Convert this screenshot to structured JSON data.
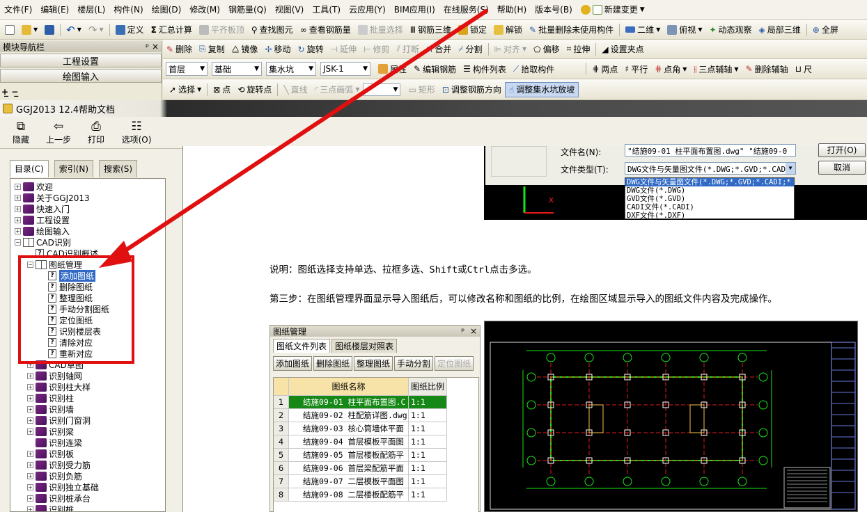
{
  "menubar": {
    "items": [
      "文件(F)",
      "编辑(E)",
      "楼层(L)",
      "构件(N)",
      "绘图(D)",
      "修改(M)",
      "钢筋量(Q)",
      "视图(V)",
      "工具(T)",
      "云应用(Y)",
      "BIM应用(I)",
      "在线服务(S)",
      "帮助(H)",
      "版本号(B)"
    ],
    "new_change": "新建变更"
  },
  "toolbar1": {
    "define": "定义",
    "summary": "汇总计算",
    "flat_slab": "平齐板顶",
    "find_element": "查找图元",
    "view_rebar": "查看钢筋量",
    "batch_select": "批量选择",
    "rebar_3d": "钢筋三维",
    "lock": "锁定",
    "unlock": "解锁",
    "batch_delete": "批量删除未使用构件",
    "view_2d": "二维",
    "view_top": "俯视",
    "dynamic_view": "动态观察",
    "local_3d": "局部三维",
    "full_screen": "全屏"
  },
  "toolbar2": {
    "delete": "删除",
    "copy": "复制",
    "mirror": "镜像",
    "move": "移动",
    "rotate": "旋转",
    "extend": "延伸",
    "trim": "修剪",
    "break": "打断",
    "merge": "合并",
    "split": "分割",
    "align": "对齐",
    "offset": "偏移",
    "stretch": "拉伸",
    "set_grip": "设置夹点"
  },
  "toolbar3": {
    "floor": "首层",
    "category": "基础",
    "element_type": "集水坑",
    "element": "JSK-1",
    "property": "属性",
    "edit_rebar": "编辑钢筋",
    "element_list": "构件列表",
    "pick_element": "拾取构件",
    "two_points": "两点",
    "parallel": "平行",
    "point_angle": "点角",
    "three_point_aux": "三点辅轴",
    "delete_aux": "删除辅轴",
    "dimension": "尺"
  },
  "toolbar4": {
    "select": "选择",
    "point": "点",
    "rotate_point": "旋转点",
    "line": "直线",
    "three_point_arc": "三点画弧",
    "rect": "矩形",
    "adjust_rebar_dir": "调整钢筋方向",
    "adjust_pit_slope": "调整集水坑放坡"
  },
  "left_nav": {
    "title": "模块导航栏",
    "project_settings": "工程设置",
    "drawing_input": "绘图输入",
    "pin": "ᵖ",
    "close": "×"
  },
  "help": {
    "title": "GGJ2013 12.4帮助文档",
    "toolbar": {
      "hide": "隐藏",
      "back": "上一步",
      "print": "打印",
      "options": "选项(O)"
    },
    "tabs": {
      "contents": "目录(C)",
      "index": "索引(N)",
      "search": "搜索(S)"
    },
    "tree": [
      {
        "label": "欢迎",
        "exp": "+",
        "icon": "book"
      },
      {
        "label": "关于GGJ2013",
        "exp": "+",
        "icon": "book"
      },
      {
        "label": "快速入门",
        "exp": "+",
        "icon": "book"
      },
      {
        "label": "工程设置",
        "exp": "+",
        "icon": "book"
      },
      {
        "label": "绘图输入",
        "exp": "+",
        "icon": "book"
      },
      {
        "label": "CAD识别",
        "exp": "−",
        "icon": "obook"
      },
      {
        "label": "CAD识别概述",
        "exp": "",
        "icon": "q",
        "indent": 1
      },
      {
        "label": "图纸管理",
        "exp": "−",
        "icon": "obook",
        "indent": 1
      },
      {
        "label": "添加图纸",
        "exp": "",
        "icon": "q",
        "indent": 2,
        "selected": true
      },
      {
        "label": "删除图纸",
        "exp": "",
        "icon": "q",
        "indent": 2
      },
      {
        "label": "整理图纸",
        "exp": "",
        "icon": "q",
        "indent": 2
      },
      {
        "label": "手动分割图纸",
        "exp": "",
        "icon": "q",
        "indent": 2
      },
      {
        "label": "定位图纸",
        "exp": "",
        "icon": "q",
        "indent": 2
      },
      {
        "label": "识别楼层表",
        "exp": "",
        "icon": "q",
        "indent": 2
      },
      {
        "label": "清除对应",
        "exp": "",
        "icon": "q",
        "indent": 2
      },
      {
        "label": "重新对应",
        "exp": "",
        "icon": "q",
        "indent": 2
      },
      {
        "label": "CAD草图",
        "exp": "+",
        "icon": "book",
        "indent": 1
      },
      {
        "label": "识别轴网",
        "exp": "+",
        "icon": "book",
        "indent": 1
      },
      {
        "label": "识别柱大样",
        "exp": "+",
        "icon": "book",
        "indent": 1
      },
      {
        "label": "识别柱",
        "exp": "+",
        "icon": "book",
        "indent": 1
      },
      {
        "label": "识别墙",
        "exp": "+",
        "icon": "book",
        "indent": 1
      },
      {
        "label": "识别门窗洞",
        "exp": "+",
        "icon": "book",
        "indent": 1
      },
      {
        "label": "识别梁",
        "exp": "+",
        "icon": "book",
        "indent": 1
      },
      {
        "label": "识别连梁",
        "exp": "",
        "icon": "book",
        "indent": 1
      },
      {
        "label": "识别板",
        "exp": "+",
        "icon": "book",
        "indent": 1
      },
      {
        "label": "识别受力筋",
        "exp": "+",
        "icon": "book",
        "indent": 1
      },
      {
        "label": "识别负筋",
        "exp": "+",
        "icon": "book",
        "indent": 1
      },
      {
        "label": "识别独立基础",
        "exp": "+",
        "icon": "book",
        "indent": 1
      },
      {
        "label": "识别桩承台",
        "exp": "+",
        "icon": "book",
        "indent": 1
      },
      {
        "label": "识别桩",
        "exp": "+",
        "icon": "book",
        "indent": 1
      }
    ],
    "content": {
      "para1": "说明：图纸选择支持单选、拉框多选、Shift或Ctrl点击多选。",
      "para2": "第三步：在图纸管理界面显示导入图纸后，可以修改名称和图纸的比例，在绘图区域显示导入的图纸文件内容及完成操作。"
    },
    "file_dialog": {
      "filename_label": "文件名(N):",
      "filename_value": "\"结施09-01 柱平面布置图.dwg\" \"结施09-0",
      "filetype_label": "文件类型(T):",
      "filetype_value": "DWG文件与矢量图文件(*.DWG;*.GVD;*.CAD",
      "open": "打开(O)",
      "cancel": "取消",
      "options": [
        "DWG文件与矢量图文件(*.DWG;*.GVD;*.CADI;*",
        "DWG文件(*.DWG)",
        "GVD文件(*.GVD)",
        "CADI文件(*.CADI)",
        "DXF文件(*.DXF)"
      ]
    },
    "drawing_manager": {
      "title": "图纸管理",
      "tabs": [
        "图纸文件列表",
        "图纸楼层对照表"
      ],
      "buttons": [
        "添加图纸",
        "删除图纸",
        "整理图纸",
        "手动分割",
        "定位图纸"
      ],
      "headers": [
        "图纸名称",
        "图纸比例"
      ],
      "rows": [
        {
          "num": "1",
          "name": "结施09-01 柱平面布置图.C",
          "scale": "1:1"
        },
        {
          "num": "2",
          "name": "结施09-02 柱配筋详图.dwg",
          "scale": "1:1"
        },
        {
          "num": "3",
          "name": "结施09-03 核心筒墙体平面",
          "scale": "1:1"
        },
        {
          "num": "4",
          "name": "结施09-04 首层模板平面图",
          "scale": "1:1"
        },
        {
          "num": "5",
          "name": "结施09-05 首层楼板配筋平",
          "scale": "1:1"
        },
        {
          "num": "6",
          "name": "结施09-06 首层梁配筋平面",
          "scale": "1:1"
        },
        {
          "num": "7",
          "name": "结施09-07 二层模板平面图",
          "scale": "1:1"
        },
        {
          "num": "8",
          "name": "结施09-08 二层楼板配筋平",
          "scale": "1:1"
        }
      ]
    }
  },
  "colors": {
    "annotation_red": "#e01010",
    "cad_green": "#19e619",
    "cad_red": "#e61919",
    "selection_blue": "#316ac5"
  }
}
